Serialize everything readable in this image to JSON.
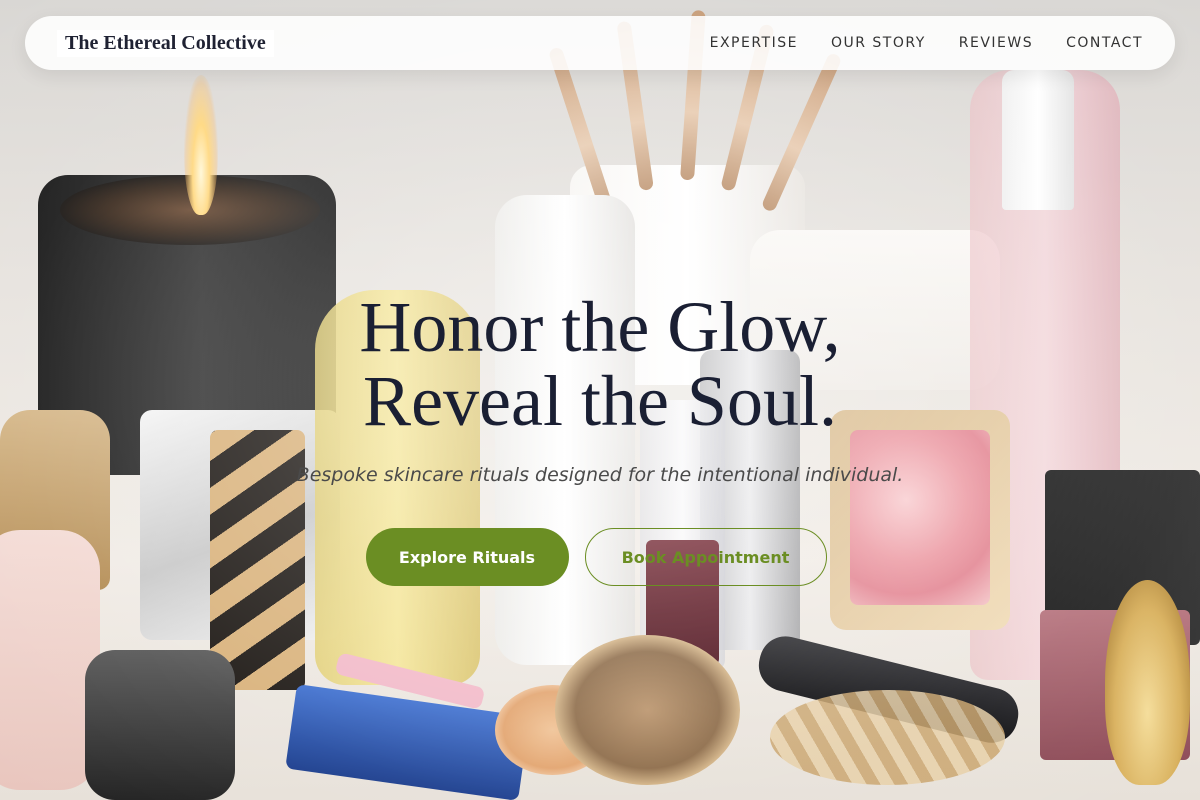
{
  "brand": {
    "name": "The Ethereal Collective"
  },
  "nav": {
    "links": [
      {
        "label": "EXPERTISE"
      },
      {
        "label": "OUR STORY"
      },
      {
        "label": "REVIEWS"
      },
      {
        "label": "CONTACT"
      }
    ]
  },
  "hero": {
    "headline_line1": "Honor the Glow,",
    "headline_line2": "Reveal the Soul.",
    "subheadline": "Bespoke skincare rituals designed for the intentional individual.",
    "primary_cta": "Explore Rituals",
    "secondary_cta": "Book Appointment"
  },
  "colors": {
    "accent": "#6b8e23",
    "headline": "#1a1f33",
    "nav_bg": "#ffffff"
  }
}
